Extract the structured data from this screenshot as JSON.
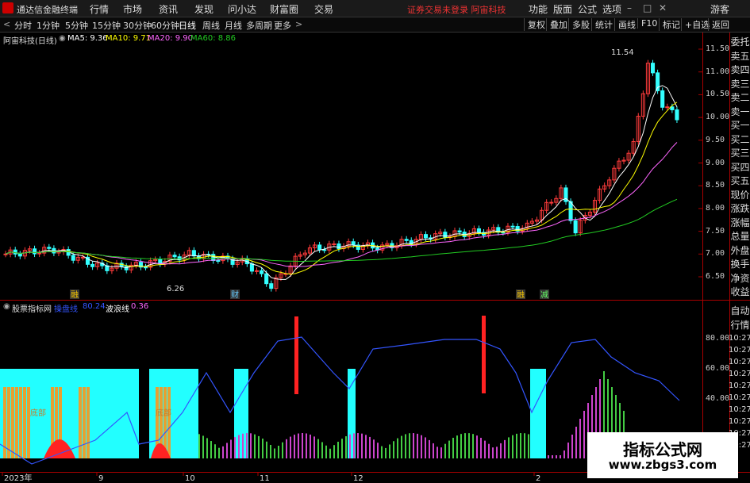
{
  "titlebar": {
    "app_name": "通达信金融终端",
    "menus": [
      "行情",
      "市场",
      "资讯",
      "发现",
      "问小达",
      "财富圈",
      "交易"
    ],
    "warning": "证券交易未登录  阿宙科技",
    "right_menus": [
      "功能",
      "版面",
      "公式",
      "选项"
    ],
    "guest": "游客"
  },
  "toolbar": {
    "periods": [
      "分时",
      "1分钟",
      "5分钟",
      "15分钟",
      "30分钟",
      "60分钟",
      "日线",
      "周线",
      "月线",
      "多周期",
      "更多"
    ],
    "right_buttons": [
      "复权",
      "叠加",
      "多股",
      "统计",
      "画线",
      "F10",
      "标记",
      "+自选",
      "返回"
    ]
  },
  "main_chart": {
    "stock": "阿宙科技(日线)",
    "ma": [
      {
        "label": "MA5: 9.36",
        "color": "#ffffff"
      },
      {
        "label": "MA10: 9.71",
        "color": "#ffff00"
      },
      {
        "label": "MA20: 9.90",
        "color": "#ff66ff"
      },
      {
        "label": "MA60: 8.86",
        "color": "#22cc22"
      }
    ],
    "high_label": "11.54",
    "low_label": "6.26",
    "y_ticks": [
      "11.50",
      "11.00",
      "10.50",
      "10.00",
      "9.50",
      "9.00",
      "8.50",
      "8.00",
      "7.50",
      "7.00",
      "6.50"
    ],
    "markers": [
      {
        "text": "融",
        "color": "#ffcc00"
      },
      {
        "text": "财",
        "color": "#66ccff"
      },
      {
        "text": "融",
        "color": "#ffcc00"
      },
      {
        "text": "减",
        "color": "#66ff66"
      }
    ]
  },
  "indicator": {
    "name": "股票指标网",
    "items": [
      {
        "label": "操盘线",
        "color": "#3355ff"
      },
      {
        "label": "80.24",
        "color": "#3355ff"
      },
      {
        "label": "波浪线",
        "color": "#ffffff"
      },
      {
        "label": "0.36",
        "color": "#ff66ff"
      }
    ],
    "y_ticks": [
      "80.00",
      "60.00",
      "40.00"
    ],
    "labels": [
      "底部",
      "底部"
    ]
  },
  "x_axis": {
    "labels": [
      "2023年",
      "9",
      "10",
      "11",
      "12",
      "2"
    ]
  },
  "side_panel": {
    "items": [
      "委托",
      "卖五",
      "卖四",
      "卖三",
      "卖二",
      "卖一",
      "买一",
      "买二",
      "买三",
      "买四",
      "买五",
      "现价",
      "涨跌",
      "涨幅",
      "总量",
      "外盘",
      "换手",
      "净资",
      "收益"
    ],
    "lower_items": [
      "自动",
      "行情"
    ],
    "times": [
      "10:27",
      "10:27",
      "10:27",
      "10:27",
      "10:27",
      "10:27",
      "10:27",
      "10:27",
      "10:27",
      "10:27"
    ]
  },
  "watermark": {
    "line1": "指标公式网",
    "line2": "www.zbgs3.com"
  }
}
